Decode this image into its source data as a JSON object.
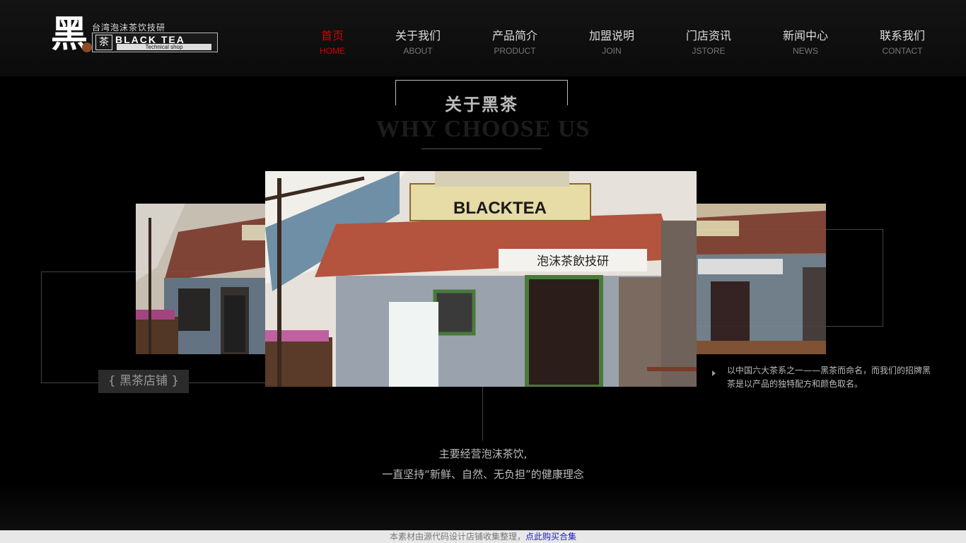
{
  "logo": {
    "mark": "黑",
    "subtitle": "台湾泡沫茶饮技研",
    "badge_cn": "茶",
    "badge_en": "BLACK TEA",
    "badge_sub": "Technical shop"
  },
  "nav": {
    "items": [
      {
        "cn": "首页",
        "en": "HOME",
        "active": true
      },
      {
        "cn": "关于我们",
        "en": "ABOUT"
      },
      {
        "cn": "产品简介",
        "en": "PRODUCT"
      },
      {
        "cn": "加盟说明",
        "en": "JOIN"
      },
      {
        "cn": "门店资讯",
        "en": "JSTORE"
      },
      {
        "cn": "新闻中心",
        "en": "NEWS"
      },
      {
        "cn": "联系我们",
        "en": "CONTACT"
      }
    ]
  },
  "section": {
    "title_cn": "关于黑茶",
    "title_en": "WHY CHOOSE US"
  },
  "gallery": {
    "shop_label": "{ 黑茶店铺 }",
    "sign_text": "BLACKTEA",
    "sign_cn": "泡沫茶飲技研"
  },
  "description": "以中国六大茶系之一——黑茶而命名，而我们的招牌黑茶是以产品的独特配方和颜色取名。",
  "slogan": {
    "line1": "主要经营泡沫茶饮,",
    "line2": "一直坚持“新鲜、自然、无负担”的健康理念"
  },
  "footer": {
    "text": "本素材由源代码设计店铺收集整理，",
    "link": "点此购买合集"
  },
  "colors": {
    "accent": "#d40000",
    "background": "#000000"
  }
}
